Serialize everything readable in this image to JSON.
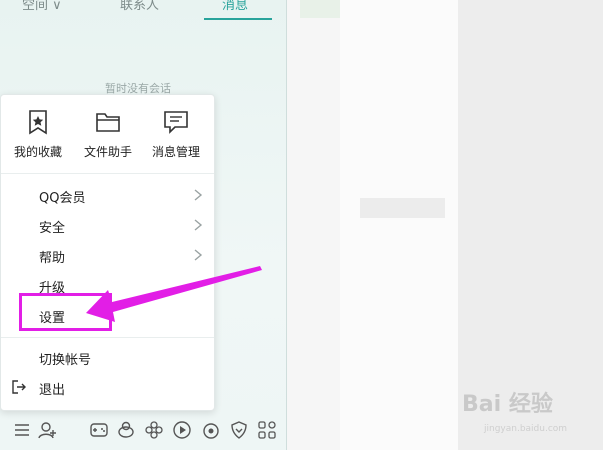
{
  "tabs": [
    {
      "label": "空间 ∨"
    },
    {
      "label": "联系人"
    },
    {
      "label": "消息"
    }
  ],
  "empty_note": "暂时没有会话",
  "quick_actions": [
    {
      "label": "我的收藏",
      "icon": "bookmark-star-icon"
    },
    {
      "label": "文件助手",
      "icon": "folder-icon"
    },
    {
      "label": "消息管理",
      "icon": "message-icon"
    }
  ],
  "menu": {
    "items": [
      {
        "label": "QQ会员",
        "has_submenu": true
      },
      {
        "label": "安全",
        "has_submenu": true
      },
      {
        "label": "帮助",
        "has_submenu": true
      },
      {
        "label": "升级",
        "has_submenu": false
      },
      {
        "label": "设置",
        "has_submenu": false
      },
      {
        "label": "切换帐号",
        "has_submenu": false
      },
      {
        "label": "退出",
        "has_submenu": false,
        "icon": "logout-icon"
      }
    ]
  },
  "toolbar": {
    "icons": [
      "menu-icon",
      "add-contact-icon",
      "game-icon",
      "pet-icon",
      "flower-icon",
      "play-icon",
      "music-icon",
      "shield-icon",
      "apps-grid-icon"
    ]
  },
  "watermark": {
    "brand": "Bai 经验",
    "sub": "jingyan.baidu.com"
  },
  "colors": {
    "accent": "#28a39b",
    "highlight": "#e21ee6"
  }
}
